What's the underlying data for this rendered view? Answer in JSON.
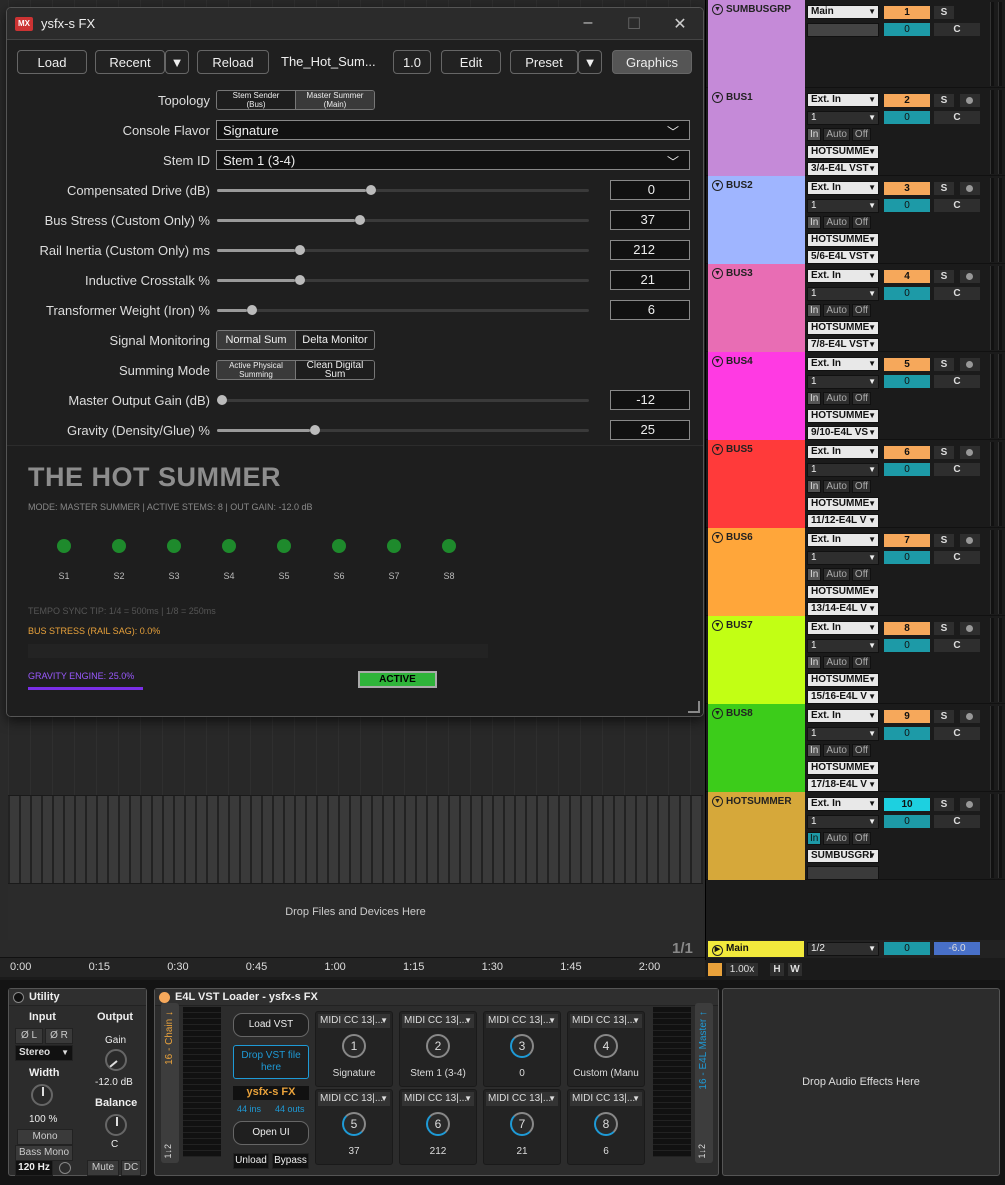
{
  "plugin_window": {
    "title": "ysfx-s FX",
    "logo": "MX",
    "toolbar": {
      "load": "Load",
      "recent": "Recent",
      "reload": "Reload",
      "preset_name": "The_Hot_Sum...",
      "version": "1.0",
      "edit": "Edit",
      "preset": "Preset",
      "graphics": "Graphics"
    },
    "params": {
      "topology": {
        "label": "Topology",
        "options": [
          "Stem Sender (Bus)",
          "Master Summer (Main)"
        ],
        "selected": "Master Summer (Main)"
      },
      "console_flavor": {
        "label": "Console Flavor",
        "value": "Signature"
      },
      "stem_id": {
        "label": "Stem ID",
        "value": "Stem 1 (3-4)"
      },
      "sliders": [
        {
          "label": "Compensated Drive (dB)",
          "value": "0",
          "fraction": 0.4
        },
        {
          "label": "Bus Stress (Custom Only) %",
          "value": "37",
          "fraction": 0.37
        },
        {
          "label": "Rail Inertia (Custom Only) ms",
          "value": "212",
          "fraction": 0.21
        },
        {
          "label": "Inductive Crosstalk %",
          "value": "21",
          "fraction": 0.21
        },
        {
          "label": "Transformer Weight (Iron) %",
          "value": "6",
          "fraction": 0.08
        }
      ],
      "signal_monitoring": {
        "label": "Signal Monitoring",
        "options": [
          "Normal Sum",
          "Delta Monitor"
        ],
        "selected": "Normal Sum"
      },
      "summing_mode": {
        "label": "Summing Mode",
        "options": [
          "Active Physical Summing",
          "Clean Digital Sum"
        ],
        "selected": "Active Physical Summing"
      },
      "sliders2": [
        {
          "label": "Master Output Gain (dB)",
          "value": "-12",
          "fraction": 0.0
        },
        {
          "label": "Gravity (Density/Glue) %",
          "value": "25",
          "fraction": 0.25
        }
      ]
    },
    "graphics": {
      "title": "THE HOT SUMMER",
      "mode_line": "MODE: MASTER SUMMER | ACTIVE STEMS: 8 | OUT GAIN: -12.0 dB",
      "stems": [
        "S1",
        "S2",
        "S3",
        "S4",
        "S5",
        "S6",
        "S7",
        "S8"
      ],
      "tempo_tip": "TEMPO SYNC TIP: 1/4 = 500ms | 1/8 = 250ms",
      "bus_stress": "BUS STRESS (RAIL SAG): 0.0%",
      "gravity": "GRAVITY ENGINE: 25.0%",
      "gravity_fraction": 0.25,
      "status": "ACTIVE"
    }
  },
  "arrangement": {
    "drop_text": "Drop Files and Devices Here",
    "pager": "1/1",
    "timeline": [
      "0:00",
      "0:15",
      "0:30",
      "0:45",
      "1:00",
      "1:15",
      "1:30",
      "1:45",
      "2:00"
    ]
  },
  "mixer": {
    "tracks": [
      {
        "name": "SUMBUSGRP",
        "color": "#c58ad8",
        "input": "Main",
        "num": "1",
        "vol": "0",
        "group": true
      },
      {
        "name": "BUS1",
        "color": "#c58ad8",
        "input": "Ext. In",
        "channel": "1",
        "device": "HOTSUMME",
        "routing": "3/4-E4L VST",
        "num": "2",
        "vol": "0"
      },
      {
        "name": "BUS2",
        "color": "#9fb5ff",
        "input": "Ext. In",
        "channel": "1",
        "device": "HOTSUMME",
        "routing": "5/6-E4L VST",
        "num": "3",
        "vol": "0"
      },
      {
        "name": "BUS3",
        "color": "#e86db4",
        "input": "Ext. In",
        "channel": "1",
        "device": "HOTSUMME",
        "routing": "7/8-E4L VST",
        "num": "4",
        "vol": "0"
      },
      {
        "name": "BUS4",
        "color": "#ff3ae3",
        "input": "Ext. In",
        "channel": "1",
        "device": "HOTSUMME",
        "routing": "9/10-E4L VS",
        "num": "5",
        "vol": "0"
      },
      {
        "name": "BUS5",
        "color": "#ff3a3a",
        "input": "Ext. In",
        "channel": "1",
        "device": "HOTSUMME",
        "routing": "11/12-E4L V",
        "num": "6",
        "vol": "0"
      },
      {
        "name": "BUS6",
        "color": "#ffa63a",
        "input": "Ext. In",
        "channel": "1",
        "device": "HOTSUMME",
        "routing": "13/14-E4L V",
        "num": "7",
        "vol": "0"
      },
      {
        "name": "BUS7",
        "color": "#c2ff14",
        "input": "Ext. In",
        "channel": "1",
        "device": "HOTSUMME",
        "routing": "15/16-E4L V",
        "num": "8",
        "vol": "0"
      },
      {
        "name": "BUS8",
        "color": "#3ccc1a",
        "input": "Ext. In",
        "channel": "1",
        "device": "HOTSUMME",
        "routing": "17/18-E4L V",
        "num": "9",
        "vol": "0"
      },
      {
        "name": "HOTSUMMER",
        "color": "#d6a83a",
        "input": "Ext. In",
        "channel": "1",
        "device": "SUMBUSGRI",
        "routing": "",
        "num": "10",
        "vol": "0"
      }
    ],
    "monitor": [
      "In",
      "Auto",
      "Off"
    ],
    "solo": "S",
    "center": "C",
    "main": {
      "name": "Main",
      "routing": "1/2",
      "vol": "0",
      "level": "-6.0"
    },
    "transport": {
      "speed": "1.00x",
      "h": "H",
      "w": "W"
    }
  },
  "utility": {
    "title": "Utility",
    "input": "Input",
    "output": "Output",
    "phase_l": "Ø L",
    "phase_r": "Ø R",
    "mode": "Stereo",
    "gain": "Gain",
    "gain_value": "-12.0 dB",
    "width": "Width",
    "width_value": "100 %",
    "mono": "Mono",
    "balance": "Balance",
    "balance_value": "C",
    "bass_mono": "Bass Mono",
    "hz": "120 Hz",
    "mute": "Mute",
    "dc": "DC"
  },
  "vst_loader": {
    "title": "E4L VST Loader - ysfx-s FX",
    "chain_in": "16 - Chain ↓",
    "chain_out": "16 - E4L Master ↑",
    "io_in": "1↓2",
    "io_out": "1↓2",
    "load_vst": "Load VST",
    "drop_vst": "Drop VST file here",
    "plugin": "ysfx-s FX",
    "ins": "44 ins",
    "outs": "44 outs",
    "open_ui": "Open UI",
    "unload": "Unload",
    "bypass": "Bypass",
    "macros": [
      {
        "header": "MIDI CC 13|...",
        "num": "1",
        "value": "Signature"
      },
      {
        "header": "MIDI CC 13|...",
        "num": "2",
        "value": "Stem 1 (3-4)"
      },
      {
        "header": "MIDI CC 13|...",
        "num": "3",
        "value": "0"
      },
      {
        "header": "MIDI CC 13|...",
        "num": "4",
        "value": "Custom (Manu"
      },
      {
        "header": "MIDI CC 13|...",
        "num": "5",
        "value": "37"
      },
      {
        "header": "MIDI CC 13|...",
        "num": "6",
        "value": "212"
      },
      {
        "header": "MIDI CC 13|...",
        "num": "7",
        "value": "21"
      },
      {
        "header": "MIDI CC 13|...",
        "num": "8",
        "value": "6"
      }
    ]
  },
  "drop_fx": "Drop Audio Effects Here"
}
